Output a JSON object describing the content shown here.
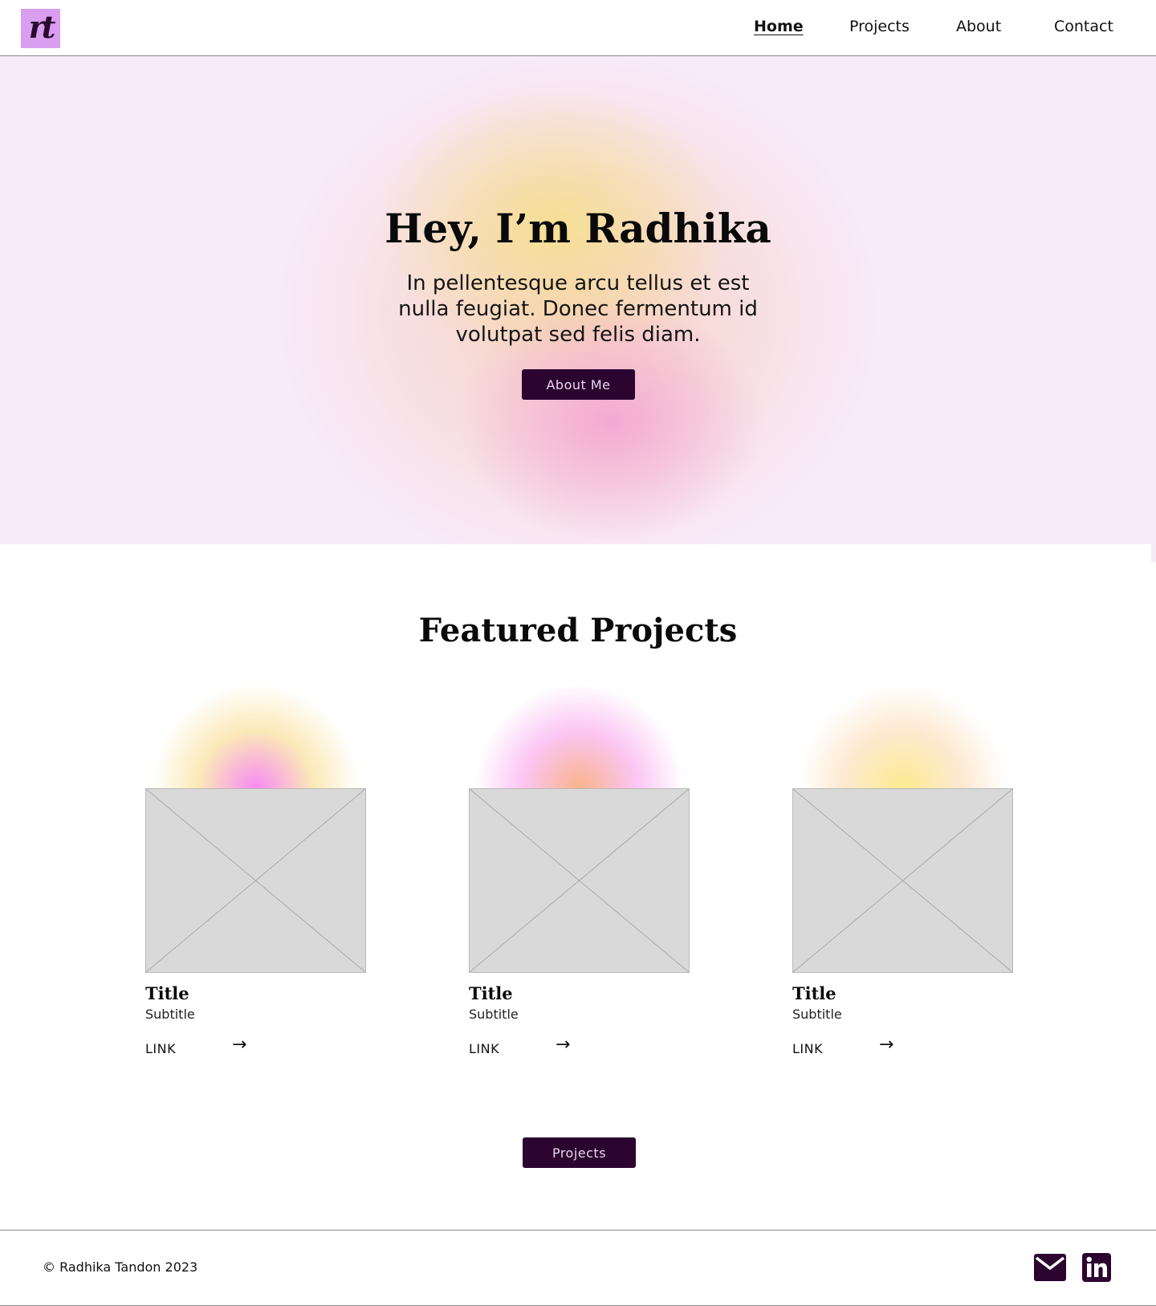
{
  "header": {
    "logo_text": "rt",
    "nav": [
      {
        "label": "Home",
        "active": true
      },
      {
        "label": "Projects",
        "active": false
      },
      {
        "label": "About",
        "active": false
      },
      {
        "label": "Contact",
        "active": false
      }
    ]
  },
  "hero": {
    "title": "Hey, I’m Radhika",
    "text": "In pellentesque arcu tellus et est nulla feugiat. Donec fermentum id volutpat sed felis diam.",
    "button_label": "About Me"
  },
  "featured": {
    "title": "Featured Projects",
    "cards": [
      {
        "title": "Title",
        "subtitle": "Subtitle",
        "link_label": "LINK",
        "arrow": "→",
        "glow_colors": [
          "#f78bf2",
          "#fbe9b8"
        ]
      },
      {
        "title": "Title",
        "subtitle": "Subtitle",
        "link_label": "LINK",
        "arrow": "→",
        "glow_colors": [
          "#f9b38b",
          "#fbc6f4"
        ]
      },
      {
        "title": "Title",
        "subtitle": "Subtitle",
        "link_label": "LINK",
        "arrow": "→",
        "glow_colors": [
          "#fdeb90",
          "#fde9cf"
        ]
      }
    ],
    "button_label": "Projects"
  },
  "footer": {
    "copyright": "© Radhika Tandon 2023",
    "icons": [
      "mail-icon",
      "linkedin-icon"
    ]
  },
  "colors": {
    "accent_dark": "#2b0530",
    "logo_bg": "#d99ef0",
    "hero_bg": "#f8eafb",
    "placeholder": "#d9d9d9"
  }
}
